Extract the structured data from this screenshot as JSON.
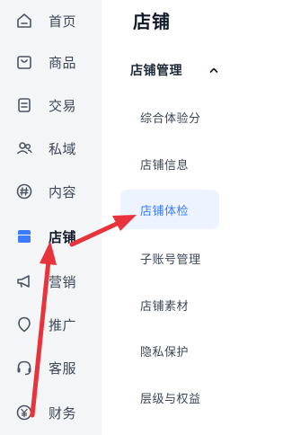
{
  "primary_nav": {
    "items": [
      {
        "label": "首页",
        "icon": "home-icon"
      },
      {
        "label": "商品",
        "icon": "goods-icon"
      },
      {
        "label": "交易",
        "icon": "trade-icon"
      },
      {
        "label": "私域",
        "icon": "users-icon"
      },
      {
        "label": "内容",
        "icon": "content-icon"
      },
      {
        "label": "店铺",
        "icon": "store-icon",
        "active": true
      },
      {
        "label": "营销",
        "icon": "megaphone-icon"
      },
      {
        "label": "推广",
        "icon": "promote-icon"
      },
      {
        "label": "客服",
        "icon": "headset-icon"
      },
      {
        "label": "财务",
        "icon": "finance-icon"
      }
    ]
  },
  "secondary_nav": {
    "title": "店铺",
    "group_label": "店铺管理",
    "group_expanded": true,
    "items": [
      {
        "label": "综合体验分"
      },
      {
        "label": "店铺信息"
      },
      {
        "label": "店铺体检",
        "active": true
      },
      {
        "label": "子账号管理"
      },
      {
        "label": "店铺素材"
      },
      {
        "label": "隐私保护"
      },
      {
        "label": "层级与权益"
      }
    ]
  },
  "colors": {
    "sidebar_bg": "#f4f5f7",
    "active_text": "#3b7bff",
    "active_bg": "#eef4ff",
    "store_icon": "#3b7bff",
    "annotation_arrow": "#e8323c"
  }
}
